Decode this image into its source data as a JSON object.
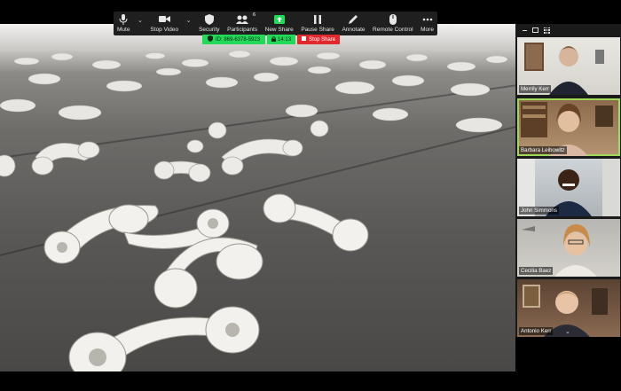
{
  "toolbar": {
    "items": [
      {
        "label": "Mute",
        "icon": "microphone-icon"
      },
      {
        "label": "Stop Video",
        "icon": "video-camera-icon"
      },
      {
        "label": "Security",
        "icon": "shield-icon"
      },
      {
        "label": "Participants",
        "icon": "participants-icon",
        "count": "6"
      },
      {
        "label": "New Share",
        "icon": "share-screen-icon"
      },
      {
        "label": "Pause Share",
        "icon": "pause-icon"
      },
      {
        "label": "Annotate",
        "icon": "pencil-icon"
      },
      {
        "label": "Remote Control",
        "icon": "mouse-icon"
      },
      {
        "label": "More",
        "icon": "more-dots-icon"
      }
    ]
  },
  "meeting": {
    "id_text": "ID: 869-6378-5923",
    "time": "14:13",
    "stop_share": "Stop Share"
  },
  "participants": [
    {
      "name": "Merrily Kerr"
    },
    {
      "name": "Barbara Leibowitz"
    },
    {
      "name": "John Simmons"
    },
    {
      "name": "Cecilia Baez"
    },
    {
      "name": "Antonio Kerr"
    }
  ],
  "colors": {
    "toolbar_bg": "#1f1f1f",
    "green": "#23d959",
    "red": "#e0282d",
    "active_speaker": "#9fd95a"
  }
}
